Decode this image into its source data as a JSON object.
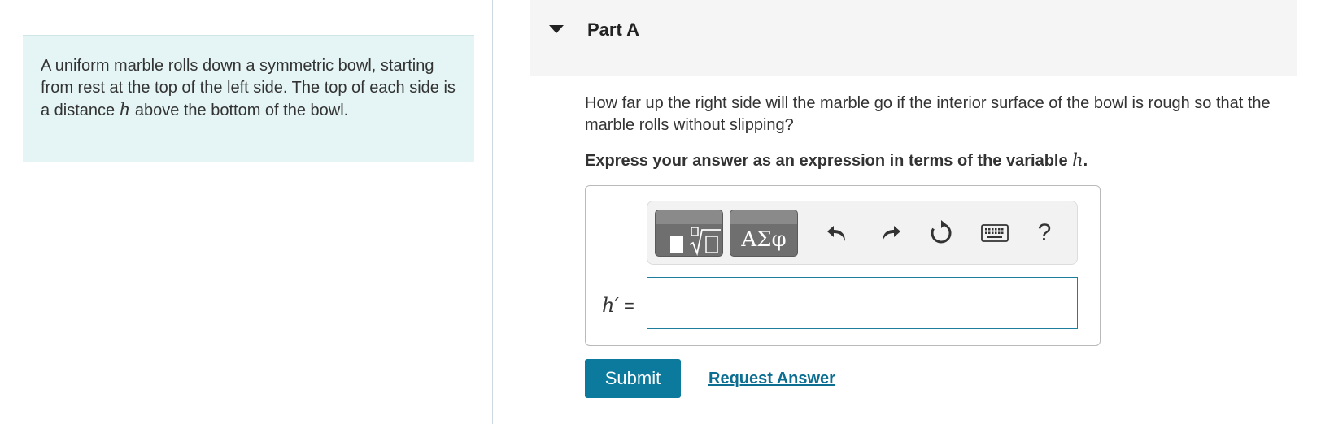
{
  "problem": {
    "text_before": "A uniform marble rolls down a symmetric bowl, starting from rest at the top of the left side. The top of each side is a distance ",
    "variable": "h",
    "text_after": " above the bottom of the bowl."
  },
  "part": {
    "title": "Part A",
    "question": "How far up the right side will the marble go if the interior surface of the bowl is rough so that the marble rolls without slipping?",
    "instruction_text": "Express your answer as an expression in terms of the variable ",
    "instruction_variable": "h",
    "instruction_end": "."
  },
  "toolbar": {
    "greek_label": "ΑΣφ",
    "help_label": "?",
    "icons": [
      "templates-icon",
      "greek-symbols-icon",
      "undo-icon",
      "redo-icon",
      "reset-icon",
      "keyboard-icon",
      "help-icon"
    ]
  },
  "answer": {
    "label_variable": "h′",
    "label_equals": " =",
    "value": "",
    "placeholder": ""
  },
  "actions": {
    "submit_label": "Submit",
    "request_answer_label": "Request Answer"
  },
  "colors": {
    "problem_background": "#e5f5f5",
    "primary_button": "#0c7a9c",
    "link": "#0c6e91",
    "input_border": "#1f7d9c"
  }
}
